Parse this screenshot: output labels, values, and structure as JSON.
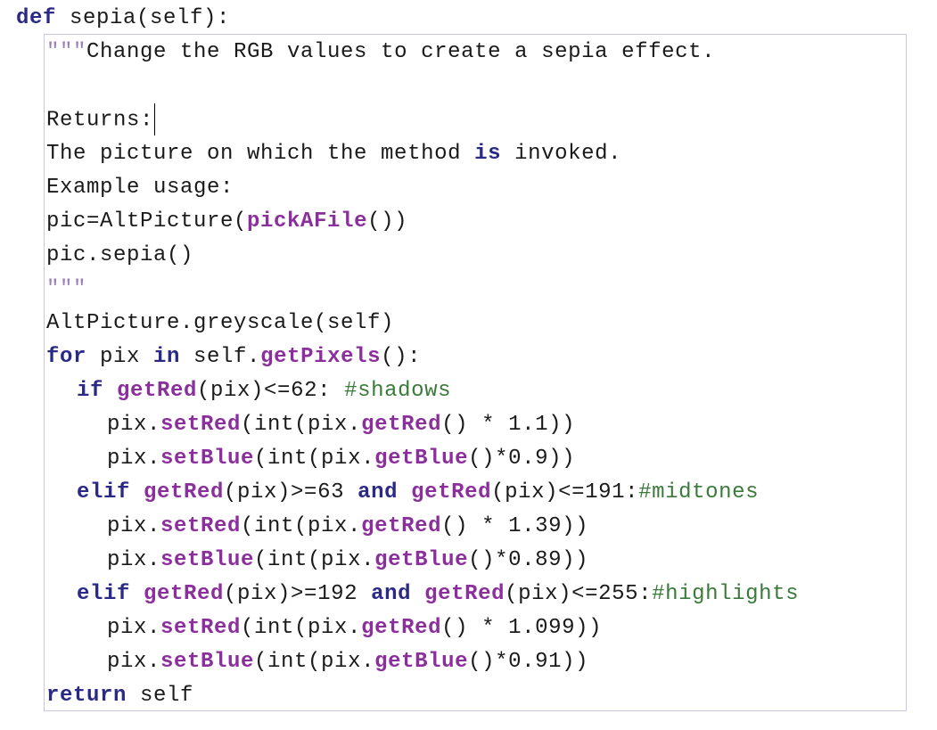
{
  "editor": {
    "lines": [
      {
        "tokens": [
          {
            "t": "def",
            "c": "kw"
          },
          {
            "t": " sepia(self):",
            "c": ""
          }
        ]
      },
      {
        "tokens": [
          {
            "t": "\"\"\"",
            "c": "q"
          },
          {
            "t": "Change the RGB values to create a sepia effect.",
            "c": "st"
          }
        ]
      },
      {
        "tokens": []
      },
      {
        "tokens": [
          {
            "t": "Returns:",
            "c": "st"
          }
        ],
        "cursor": true
      },
      {
        "tokens": [
          {
            "t": "The picture on which the method ",
            "c": "st"
          },
          {
            "t": "is",
            "c": "kw"
          },
          {
            "t": " invoked.",
            "c": "st"
          }
        ]
      },
      {
        "tokens": [
          {
            "t": "Example usage:",
            "c": "st"
          }
        ]
      },
      {
        "tokens": [
          {
            "t": "pic=AltPicture(",
            "c": "st"
          },
          {
            "t": "pickAFile",
            "c": "fn"
          },
          {
            "t": "())",
            "c": "st"
          }
        ]
      },
      {
        "tokens": [
          {
            "t": "pic.sepia()",
            "c": "st"
          }
        ]
      },
      {
        "tokens": [
          {
            "t": "\"\"\"",
            "c": "q"
          }
        ]
      },
      {
        "tokens": [
          {
            "t": "AltPicture.greyscale(self)",
            "c": ""
          }
        ]
      },
      {
        "tokens": [
          {
            "t": "for",
            "c": "kw"
          },
          {
            "t": " pix ",
            "c": ""
          },
          {
            "t": "in",
            "c": "kw"
          },
          {
            "t": " self.",
            "c": ""
          },
          {
            "t": "getPixels",
            "c": "fn"
          },
          {
            "t": "():",
            "c": ""
          }
        ]
      },
      {
        "tokens": [
          {
            "t": "if",
            "c": "kw"
          },
          {
            "t": " ",
            "c": ""
          },
          {
            "t": "getRed",
            "c": "fn"
          },
          {
            "t": "(pix)<=62: ",
            "c": ""
          },
          {
            "t": "#shadows",
            "c": "cm"
          }
        ]
      },
      {
        "tokens": [
          {
            "t": "pix.",
            "c": ""
          },
          {
            "t": "setRed",
            "c": "fn"
          },
          {
            "t": "(int(pix.",
            "c": ""
          },
          {
            "t": "getRed",
            "c": "fn"
          },
          {
            "t": "() * 1.1))",
            "c": ""
          }
        ]
      },
      {
        "tokens": [
          {
            "t": "pix.",
            "c": ""
          },
          {
            "t": "setBlue",
            "c": "fn"
          },
          {
            "t": "(int(pix.",
            "c": ""
          },
          {
            "t": "getBlue",
            "c": "fn"
          },
          {
            "t": "()*0.9))",
            "c": ""
          }
        ]
      },
      {
        "tokens": [
          {
            "t": "elif",
            "c": "kw"
          },
          {
            "t": " ",
            "c": ""
          },
          {
            "t": "getRed",
            "c": "fn"
          },
          {
            "t": "(pix)>=63 ",
            "c": ""
          },
          {
            "t": "and",
            "c": "kw"
          },
          {
            "t": " ",
            "c": ""
          },
          {
            "t": "getRed",
            "c": "fn"
          },
          {
            "t": "(pix)<=191:",
            "c": ""
          },
          {
            "t": "#midtones",
            "c": "cm"
          }
        ]
      },
      {
        "tokens": [
          {
            "t": "pix.",
            "c": ""
          },
          {
            "t": "setRed",
            "c": "fn"
          },
          {
            "t": "(int(pix.",
            "c": ""
          },
          {
            "t": "getRed",
            "c": "fn"
          },
          {
            "t": "() * 1.39))",
            "c": ""
          }
        ]
      },
      {
        "tokens": [
          {
            "t": "pix.",
            "c": ""
          },
          {
            "t": "setBlue",
            "c": "fn"
          },
          {
            "t": "(int(pix.",
            "c": ""
          },
          {
            "t": "getBlue",
            "c": "fn"
          },
          {
            "t": "()*0.89))",
            "c": ""
          }
        ]
      },
      {
        "tokens": [
          {
            "t": "elif",
            "c": "kw"
          },
          {
            "t": " ",
            "c": ""
          },
          {
            "t": "getRed",
            "c": "fn"
          },
          {
            "t": "(pix)>=192 ",
            "c": ""
          },
          {
            "t": "and",
            "c": "kw"
          },
          {
            "t": " ",
            "c": ""
          },
          {
            "t": "getRed",
            "c": "fn"
          },
          {
            "t": "(pix)<=255:",
            "c": ""
          },
          {
            "t": "#highlights",
            "c": "cm"
          }
        ]
      },
      {
        "tokens": [
          {
            "t": "pix.",
            "c": ""
          },
          {
            "t": "setRed",
            "c": "fn"
          },
          {
            "t": "(int(pix.",
            "c": ""
          },
          {
            "t": "getRed",
            "c": "fn"
          },
          {
            "t": "() * 1.099))",
            "c": ""
          }
        ]
      },
      {
        "tokens": [
          {
            "t": "pix.",
            "c": ""
          },
          {
            "t": "setBlue",
            "c": "fn"
          },
          {
            "t": "(int(pix.",
            "c": ""
          },
          {
            "t": "getBlue",
            "c": "fn"
          },
          {
            "t": "()*0.91))",
            "c": ""
          }
        ]
      },
      {
        "tokens": [
          {
            "t": "return",
            "c": "kw"
          },
          {
            "t": " self",
            "c": ""
          }
        ]
      }
    ]
  }
}
